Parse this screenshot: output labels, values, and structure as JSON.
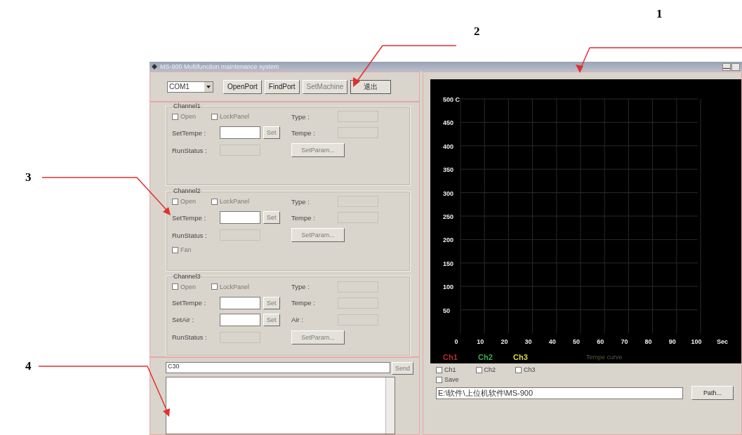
{
  "callouts": [
    {
      "label": "1"
    },
    {
      "label": "2"
    },
    {
      "label": "3"
    },
    {
      "label": "4"
    }
  ],
  "window": {
    "title": "MS-900 Multifunction maintenance system"
  },
  "toolbar": {
    "port": "COM1",
    "buttons": [
      {
        "label": "OpenPort",
        "disabled": false
      },
      {
        "label": "FindPort",
        "disabled": false
      },
      {
        "label": "SetMachine",
        "disabled": true
      },
      {
        "label": "退出",
        "disabled": false
      }
    ]
  },
  "channels": [
    {
      "title": "Channel1",
      "options": [
        {
          "label": "Open",
          "checked": false
        },
        {
          "label": "LockPanel",
          "checked": false
        }
      ],
      "setters": [
        {
          "label": "SetTempe :",
          "button": "Set"
        }
      ],
      "readouts": [
        {
          "label": "Type :"
        },
        {
          "label": "Tempe :"
        }
      ],
      "run_status": "RunStatus :",
      "param_button": "SetParam..."
    },
    {
      "title": "Channel2",
      "options": [
        {
          "label": "Open",
          "checked": false
        },
        {
          "label": "LockPanel",
          "checked": false
        }
      ],
      "setters": [
        {
          "label": "SetTempe :",
          "button": "Set"
        }
      ],
      "readouts": [
        {
          "label": "Type :"
        },
        {
          "label": "Tempe :"
        }
      ],
      "run_status": "RunStatus :",
      "param_button": "SetParam...",
      "extras": [
        {
          "label": "Fan",
          "checked": false
        }
      ]
    },
    {
      "title": "Channel3",
      "options": [
        {
          "label": "Open",
          "checked": false
        },
        {
          "label": "LockPanel",
          "checked": false
        }
      ],
      "setters": [
        {
          "label": "SetTempe :",
          "button": "Set"
        },
        {
          "label": "SetAir :",
          "button": "Set"
        }
      ],
      "readouts": [
        {
          "label": "Type :"
        },
        {
          "label": "Tempe :"
        },
        {
          "label": "Air :"
        }
      ],
      "run_status": "RunStatus :",
      "param_button": "SetParam..."
    }
  ],
  "console": {
    "command": "C30",
    "send_button": "Send"
  },
  "chart": {
    "chart_data": {
      "type": "line",
      "title": "Tempe curve",
      "xlabel": "Sec",
      "grid": true,
      "ylim": [
        0,
        500
      ],
      "categories": [
        "0",
        "10",
        "20",
        "30",
        "40",
        "50",
        "60",
        "70",
        "80",
        "90",
        "100"
      ],
      "yticks": [
        50,
        100,
        150,
        200,
        250,
        300,
        350,
        400,
        {
          "value": 450,
          "label": "450"
        },
        {
          "value": 500,
          "label": "500 C"
        }
      ],
      "series": [
        {
          "name": "Ch1",
          "color": "#c0282d",
          "values": [
            null,
            null,
            null,
            null,
            null,
            null,
            null,
            null,
            null,
            null,
            null
          ]
        },
        {
          "name": "Ch2",
          "color": "#3fae49",
          "values": [
            null,
            null,
            null,
            null,
            null,
            null,
            null,
            null,
            null,
            null,
            null
          ]
        },
        {
          "name": "Ch3",
          "color": "#d8d84a",
          "values": [
            null,
            null,
            null,
            null,
            null,
            null,
            null,
            null,
            null,
            null,
            null
          ]
        }
      ]
    }
  },
  "display_options": [
    {
      "label": "Ch1",
      "checked": false
    },
    {
      "label": "Ch2",
      "checked": false
    },
    {
      "label": "Ch3",
      "checked": false
    }
  ],
  "save": {
    "label": "Save",
    "checked": false
  },
  "path": {
    "value": "E:\\软件\\上位机软件\\MS-900",
    "button": "Path..."
  }
}
